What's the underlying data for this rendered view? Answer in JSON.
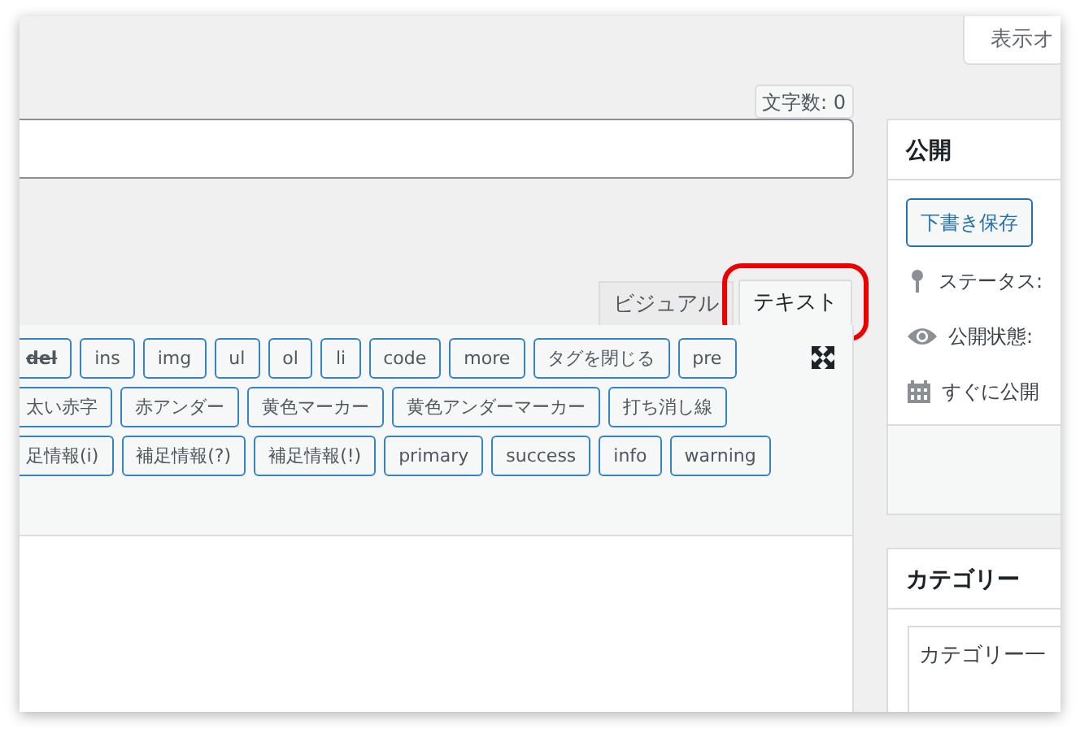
{
  "screen_options": {
    "label": "表示オ"
  },
  "word_count": "文字数: 0",
  "editor_tabs": [
    {
      "label": "ビジュアル",
      "selected": false,
      "highlighted": false
    },
    {
      "label": "テキスト",
      "selected": true,
      "highlighted": true
    }
  ],
  "quicktags": [
    [
      {
        "label": "del",
        "kind": "strike"
      },
      {
        "label": "ins",
        "kind": "plain"
      },
      {
        "label": "img",
        "kind": "plain"
      },
      {
        "label": "ul",
        "kind": "plain"
      },
      {
        "label": "ol",
        "kind": "plain"
      },
      {
        "label": "li",
        "kind": "plain"
      },
      {
        "label": "code",
        "kind": "plain"
      },
      {
        "label": "more",
        "kind": "plain"
      },
      {
        "label": "タグを閉じる",
        "kind": "plain"
      },
      {
        "label": "pre",
        "kind": "plain"
      }
    ],
    [
      {
        "label": "太い赤字",
        "kind": "plain"
      },
      {
        "label": "赤アンダー",
        "kind": "plain"
      },
      {
        "label": "黄色マーカー",
        "kind": "plain"
      },
      {
        "label": "黄色アンダーマーカー",
        "kind": "plain"
      },
      {
        "label": "打ち消し線",
        "kind": "plain"
      }
    ],
    [
      {
        "label": "足情報(i)",
        "kind": "plain"
      },
      {
        "label": "補足情報(?)",
        "kind": "plain"
      },
      {
        "label": "補足情報(!)",
        "kind": "plain"
      },
      {
        "label": "primary",
        "kind": "plain"
      },
      {
        "label": "success",
        "kind": "plain"
      },
      {
        "label": "info",
        "kind": "plain"
      },
      {
        "label": "warning",
        "kind": "plain"
      }
    ]
  ],
  "publish_box": {
    "title": "公開",
    "save_draft": "下書き保存",
    "rows": [
      {
        "kind": "status",
        "label": "ステータス:"
      },
      {
        "kind": "visibility",
        "label": "公開状態:"
      },
      {
        "kind": "schedule",
        "label": "すぐに公開"
      }
    ]
  },
  "category_box": {
    "title": "カテゴリー",
    "tab": "カテゴリー一"
  }
}
